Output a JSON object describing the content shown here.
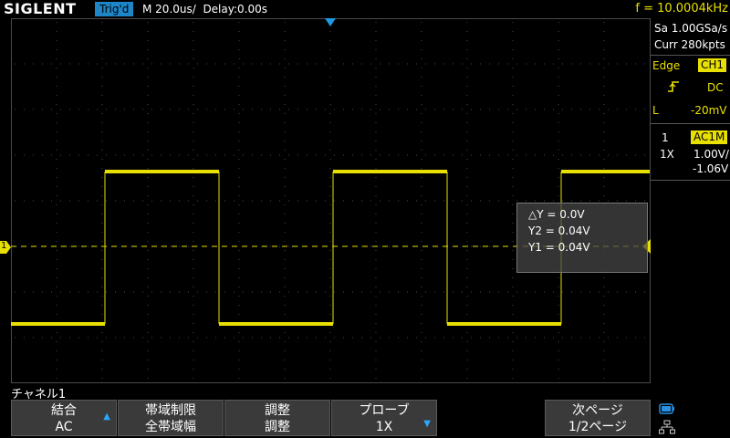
{
  "header": {
    "brand": "SIGLENT",
    "trigger_status": "Trig'd",
    "timebase": "M 20.0us/",
    "delay": "Delay:0.00s",
    "frequency": "f = 10.0004kHz"
  },
  "acquisition": {
    "sample_rate": "Sa 1.00GSa/s",
    "memory": "Curr 280kpts"
  },
  "trigger_panel": {
    "type": "Edge",
    "source": "CH1",
    "slope_icon": "rising-edge-icon",
    "coupling": "DC",
    "level_label": "L",
    "level": "-20mV"
  },
  "channel_panel": {
    "number": "1",
    "coupling": "AC1M",
    "probe": "1X",
    "scale": "1.00V/",
    "offset": "-1.06V"
  },
  "cursor_box": {
    "delta": "△Y = 0.0V",
    "y2": "Y2 = 0.04V",
    "y1": "Y1 = 0.04V"
  },
  "channel_marker": "1",
  "menu": {
    "title": "チャネル1",
    "buttons": [
      {
        "line1": "結合",
        "line2": "AC"
      },
      {
        "line1": "帯域制限",
        "line2": "全帯域幅"
      },
      {
        "line1": "調整",
        "line2": "調整"
      },
      {
        "line1": "プローブ",
        "line2": "1X"
      },
      {
        "line1": "次ページ",
        "line2": "1/2ページ"
      }
    ]
  },
  "waveform": {
    "high_level_v": 1.0,
    "low_level_v": -1.0,
    "period_us": 100
  },
  "colors": {
    "ch1": "#e8e000",
    "trigger_accent": "#1c86c8",
    "grid": "#3a3a3a"
  }
}
